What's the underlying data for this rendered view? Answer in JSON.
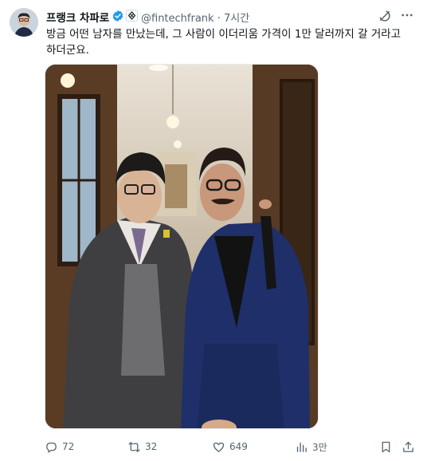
{
  "author": {
    "display_name": "프랭크 차파로",
    "handle": "@fintechfrank",
    "separator": "·",
    "time": "7시간"
  },
  "tweet": {
    "text": "방금 어떤 남자를 만났는데, 그 사람이 이더리움 가격이 1만 달러까지 갈 거라고 하더군요."
  },
  "metrics": {
    "replies": "72",
    "reposts": "32",
    "likes": "649",
    "views": "3만"
  },
  "icons": {
    "verified": "verified-badge-icon",
    "org": "affiliate-org-icon",
    "grok": "grok-icon",
    "more": "more-icon",
    "reply": "reply-icon",
    "repost": "repost-icon",
    "like": "like-icon",
    "views": "views-icon",
    "bookmark": "bookmark-icon",
    "share": "share-icon"
  },
  "colors": {
    "accent": "#1d9bf0",
    "secondary_text": "#536471",
    "primary_text": "#0f1419"
  }
}
